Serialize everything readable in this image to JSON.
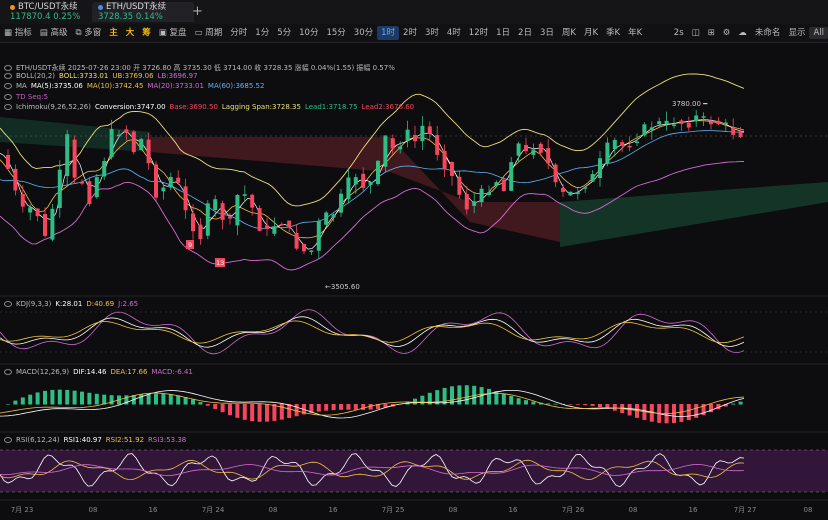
{
  "tabs": [
    {
      "symbol": "BTC/USDT永续",
      "price": "117870.4",
      "change": "0.25%",
      "color": "#2ebd85",
      "active": false
    },
    {
      "symbol": "ETH/USDT永续",
      "price": "3728.35",
      "change": "0.14%",
      "color": "#2ebd85",
      "active": true
    }
  ],
  "toolbar": {
    "items": [
      "指标",
      "高级",
      "多窗",
      "复盘",
      "周期",
      "分时",
      "1分",
      "5分",
      "10分",
      "15分",
      "30分",
      "1时",
      "2时",
      "3时",
      "4时",
      "12时",
      "1日",
      "2日",
      "3日",
      "周K",
      "月K",
      "季K",
      "年K"
    ],
    "selected": "1时",
    "drawing": [
      "主",
      "大",
      "筹"
    ],
    "right": [
      "2s",
      "未命名",
      "显示",
      "All"
    ]
  },
  "indicators": {
    "main": "ETH/USDT永续 2025-07-26 23:00  开 3726.80  高 3735.30  低 3714.00  收 3728.35  涨幅 0.04%(1.55)  振幅 0.57%",
    "boll": {
      "name": "BOLL(20,2)",
      "boll": "BOLL:3733.01",
      "ub": "UB:3769.06",
      "lb": "LB:3696.97"
    },
    "ma": {
      "name": "MA",
      "ma5": "MA(5):3735.06",
      "ma10": "MA(10):3742.45",
      "ma20": "MA(20):3733.01",
      "ma60": "MA(60):3685.52"
    },
    "td": "TD Seq:5",
    "ichimoku": {
      "name": "Ichimoku(9,26,52,26)",
      "conv": "Conversion:3747.00",
      "base": "Base:3690.50",
      "lag": "Lagging Span:3728.35",
      "lead1": "Lead1:3718.75",
      "lead2": "Lead2:3676.60"
    },
    "kdj": {
      "name": "KDJ(9,3,3)",
      "k": "K:28.01",
      "d": "D:40.69",
      "j": "J:2.65"
    },
    "macd": {
      "name": "MACD(12,26,9)",
      "dif": "DIF:14.46",
      "dea": "DEA:17.66",
      "macd": "MACD:-6.41"
    },
    "rsi": {
      "name": "RSI(6,12,24)",
      "r1": "RSI1:40.97",
      "r2": "RSI2:51.92",
      "r3": "RSI3:53.38"
    }
  },
  "annotations": {
    "high_label": "3780.00",
    "low_label": "3505.60",
    "td9": "9",
    "td13": "13"
  },
  "x_axis_labels": [
    "7月 23",
    "08",
    "16",
    "7月 24",
    "08",
    "16",
    "7月 25",
    "08",
    "16",
    "7月 26",
    "08",
    "16",
    "7月 27",
    "08"
  ],
  "colors": {
    "up": "#2ebd85",
    "down": "#f6465d",
    "boll": "#e8e07a",
    "ma5": "#ffffff",
    "ma10": "#f0c040",
    "ma20": "#d36bd3",
    "ma60": "#5fb3f5"
  }
}
